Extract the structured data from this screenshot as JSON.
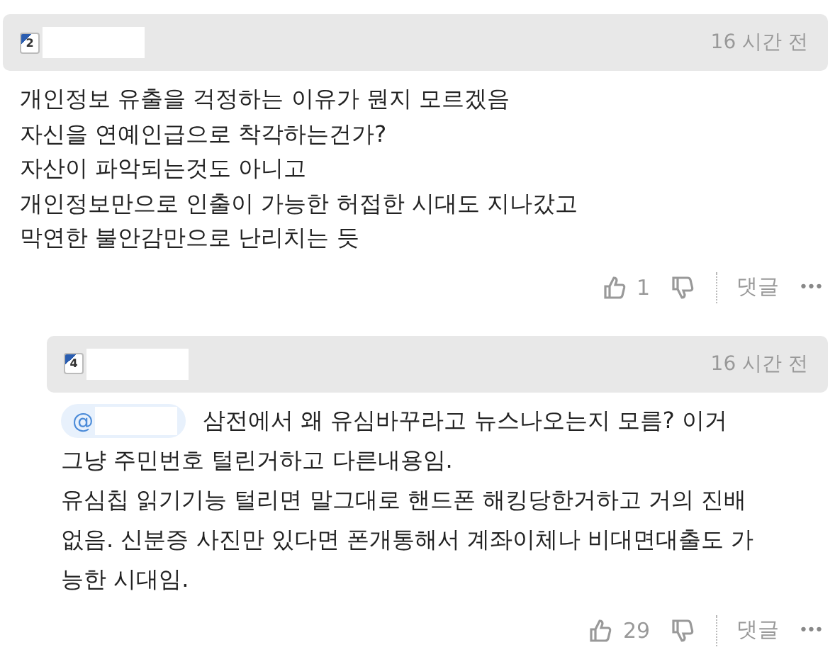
{
  "comments": [
    {
      "level": "2",
      "time": "16 시간 전",
      "mention": false,
      "lines": [
        "개인정보 유출을 걱정하는 이유가 뭔지 모르겠음",
        "자신을 연예인급으로 착각하는건가?",
        "자산이 파악되는것도 아니고",
        "개인정보만으로 인출이 가능한 허접한 시대도 지나갔고",
        "막연한 불안감만으로 난리치는 듯"
      ],
      "likes": "1",
      "reply_label": "댓글",
      "more": "•••"
    },
    {
      "level": "4",
      "time": "16 시간 전",
      "mention": true,
      "mention_at": "@",
      "lines": [
        "삼전에서 왜 유심바꾸라고 뉴스나오는지 모름? 이거",
        "그냥 주민번호 털린거하고 다른내용임.",
        "유심칩 읽기기능 털리면 말그대로 핸드폰 해킹당한거하고 거의 진배",
        "없음. 신분증 사진만 있다면 폰개통해서 계좌이체나 비대면대출도 가",
        "능한 시대임."
      ],
      "likes": "29",
      "reply_label": "댓글",
      "more": "•••"
    }
  ]
}
